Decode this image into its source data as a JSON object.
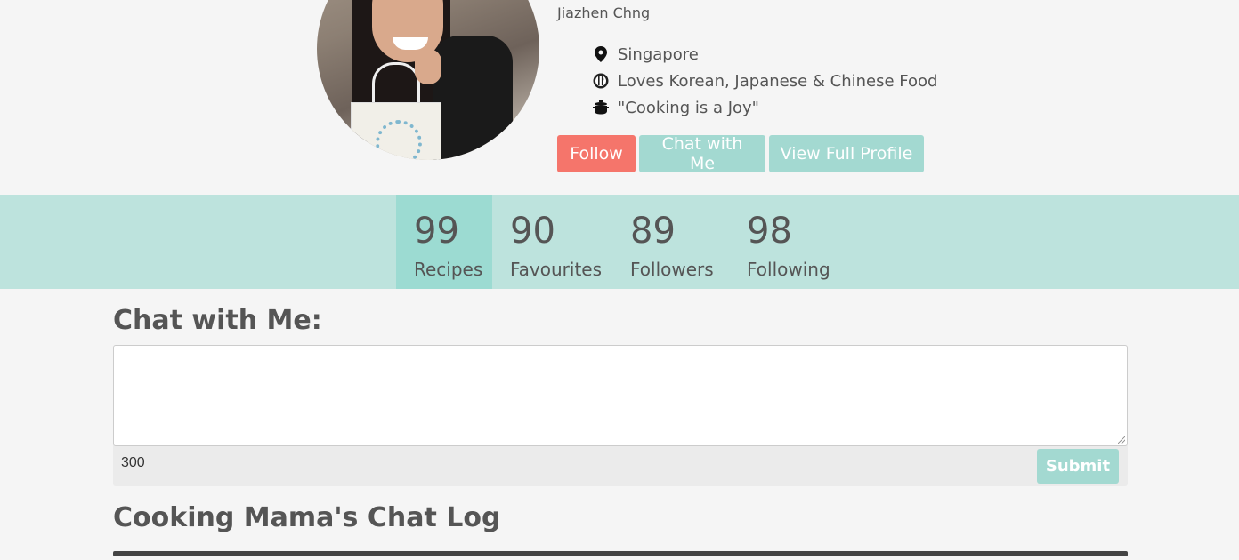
{
  "profile": {
    "name": "Jiazhen Chng",
    "details": [
      {
        "icon": "map-pin-icon",
        "text": "Singapore"
      },
      {
        "icon": "utensils-icon",
        "text": "Loves Korean, Japanese & Chinese Food"
      },
      {
        "icon": "cooking-pot-icon",
        "text": "\"Cooking is a Joy\""
      }
    ],
    "actions": {
      "follow": "Follow",
      "chat": "Chat with Me",
      "view_profile": "View Full Profile"
    }
  },
  "stats": [
    {
      "num": "99",
      "label": "Recipes",
      "active": true
    },
    {
      "num": "90",
      "label": "Favourites",
      "active": false
    },
    {
      "num": "89",
      "label": "Followers",
      "active": false
    },
    {
      "num": "98",
      "label": "Following",
      "active": false
    }
  ],
  "chat": {
    "title": "Chat with Me:",
    "textarea_value": "",
    "char_count": "300",
    "submit": "Submit"
  },
  "log": {
    "title": "Cooking Mama's Chat Log"
  },
  "colors": {
    "follow": "#f5756b",
    "accent": "#a3d9d1",
    "stats_bg": "#bde3dd",
    "stats_active": "#9cdbd2"
  }
}
